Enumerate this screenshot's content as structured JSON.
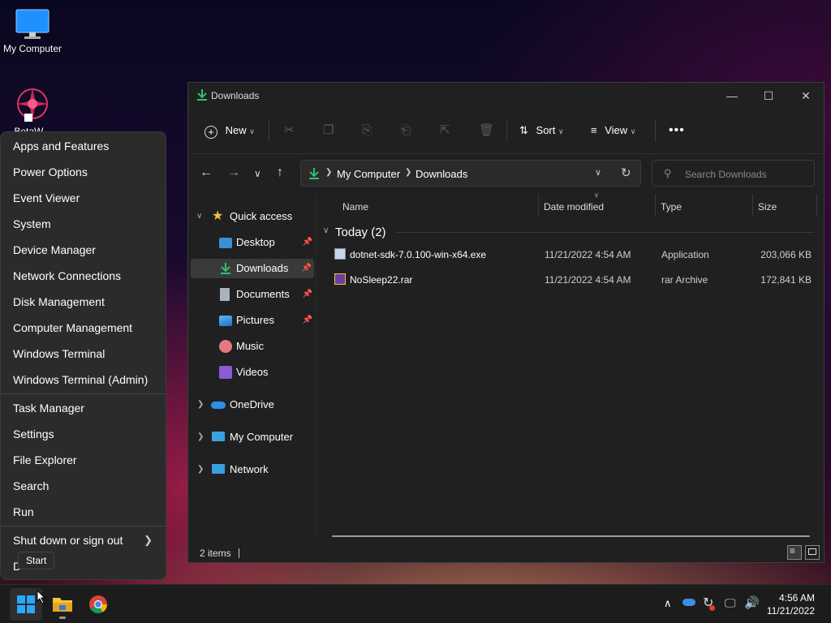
{
  "desktop": {
    "icons": [
      {
        "label": "My Computer"
      },
      {
        "label": "BetaW..."
      }
    ]
  },
  "context_menu": {
    "group1": [
      "Apps and Features",
      "Power Options",
      "Event Viewer",
      "System",
      "Device Manager",
      "Network Connections",
      "Disk Management",
      "Computer Management",
      "Windows Terminal",
      "Windows Terminal (Admin)"
    ],
    "group2": [
      "Task Manager",
      "Settings",
      "File Explorer",
      "Search",
      "Run"
    ],
    "shutdown": "Shut down or sign out",
    "desktop_partial": "D",
    "tooltip": "Start"
  },
  "explorer": {
    "title": "Downloads",
    "toolbar": {
      "new_label": "New",
      "sort_label": "Sort",
      "view_label": "View"
    },
    "breadcrumb": [
      "My Computer",
      "Downloads"
    ],
    "search_placeholder": "Search Downloads",
    "nav_pane": {
      "quick_access": "Quick access",
      "items": [
        "Desktop",
        "Downloads",
        "Documents",
        "Pictures",
        "Music",
        "Videos"
      ],
      "onedrive": "OneDrive",
      "my_computer": "My Computer",
      "network": "Network"
    },
    "columns": {
      "name": "Name",
      "date": "Date modified",
      "type": "Type",
      "size": "Size"
    },
    "group_label": "Today (2)",
    "files": [
      {
        "name": "dotnet-sdk-7.0.100-win-x64.exe",
        "date": "11/21/2022 4:54 AM",
        "type": "Application",
        "size": "203,066 KB"
      },
      {
        "name": "NoSleep22.rar",
        "date": "11/21/2022 4:54 AM",
        "type": "rar Archive",
        "size": "172,841 KB"
      }
    ],
    "status": "2 items"
  },
  "taskbar": {
    "time": "4:56 AM",
    "date": "11/21/2022"
  },
  "colors": {
    "accent": "#3aa0ff",
    "download_green": "#2fbf71",
    "folder_yellow": "#f3c53b"
  }
}
